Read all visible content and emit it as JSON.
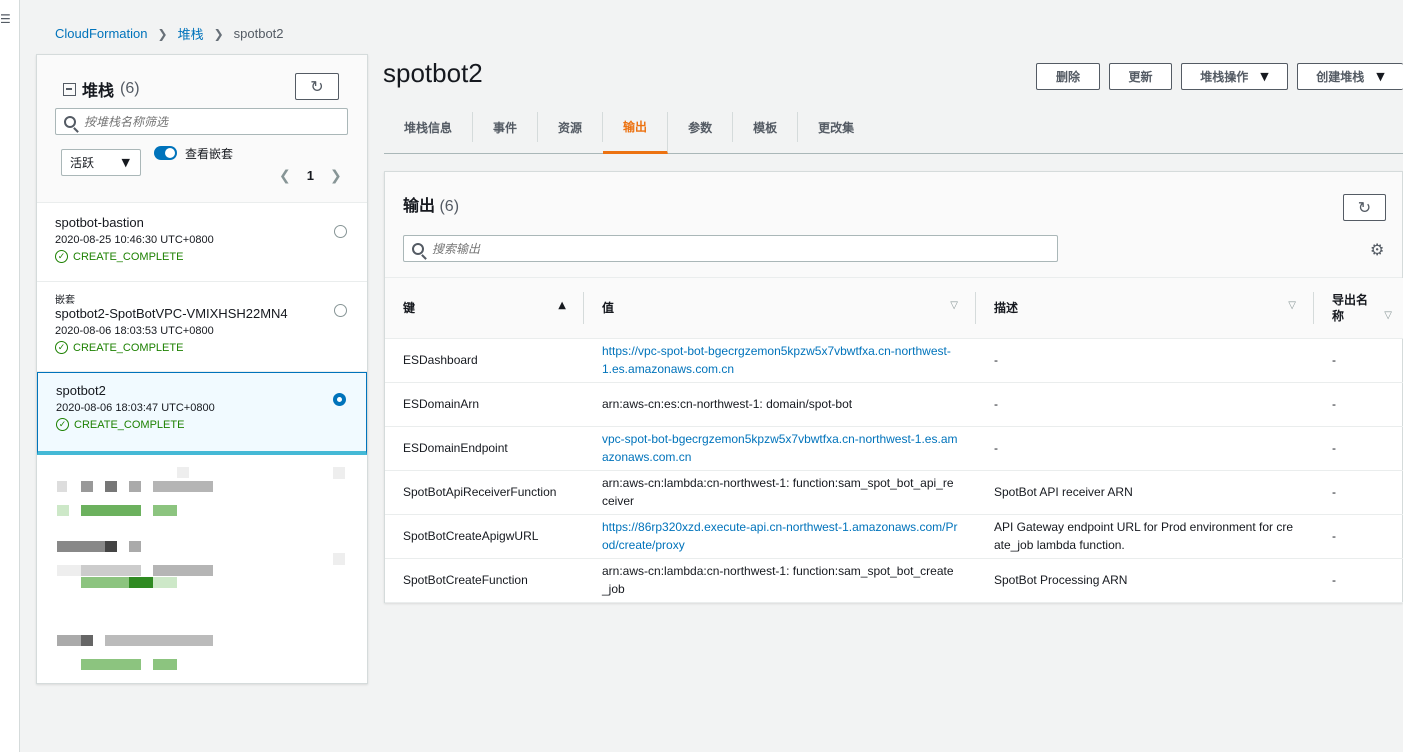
{
  "breadcrumb": {
    "items": [
      "CloudFormation",
      "堆栈"
    ],
    "current": "spotbot2"
  },
  "stacks_panel": {
    "title": "堆栈",
    "count": "(6)",
    "search_placeholder": "按堆栈名称筛选",
    "status_filter": "活跃",
    "toggle_label": "查看嵌套",
    "page": "1",
    "items": [
      {
        "nested_label": "",
        "name": "spotbot-bastion",
        "time": "2020-08-25 10:46:30 UTC+0800",
        "status": "CREATE_COMPLETE"
      },
      {
        "nested_label": "嵌套",
        "name": "spotbot2-SpotBotVPC-VMIXHSH22MN4",
        "time": "2020-08-06 18:03:53 UTC+0800",
        "status": "CREATE_COMPLETE"
      },
      {
        "nested_label": "",
        "name": "spotbot2",
        "time": "2020-08-06 18:03:47 UTC+0800",
        "status": "CREATE_COMPLETE"
      }
    ]
  },
  "page": {
    "title": "spotbot2",
    "buttons": {
      "delete": "删除",
      "update": "更新",
      "stack_actions": "堆栈操作",
      "create_stack": "创建堆栈"
    }
  },
  "tabs": [
    "堆栈信息",
    "事件",
    "资源",
    "输出",
    "参数",
    "模板",
    "更改集"
  ],
  "outputs": {
    "title": "输出",
    "count": "(6)",
    "search_placeholder": "搜索输出",
    "columns": [
      "键",
      "值",
      "描述",
      "导出名称"
    ],
    "rows": [
      {
        "key": "ESDashboard",
        "value": "https://vpc-spot-bot-bgecrgzemon5kpzw5x7vbwtfxa.cn-northwest-1.es.amazonaws.com.cn",
        "link": true,
        "desc": "-",
        "export": "-"
      },
      {
        "key": "ESDomainArn",
        "value": "arn:aws-cn:es:cn-northwest-1:                    domain/spot-bot",
        "link": false,
        "desc": "-",
        "export": "-"
      },
      {
        "key": "ESDomainEndpoint",
        "value": "vpc-spot-bot-bgecrgzemon5kpzw5x7vbwtfxa.cn-northwest-1.es.amazonaws.com.cn",
        "link": true,
        "desc": "-",
        "export": "-"
      },
      {
        "key": "SpotBotApiReceiverFunction",
        "value": "arn:aws-cn:lambda:cn-northwest-1:                    function:sam_spot_bot_api_receiver",
        "link": false,
        "desc": "SpotBot API receiver ARN",
        "export": "-"
      },
      {
        "key": "SpotBotCreateApigwURL",
        "value": "https://86rp320xzd.execute-api.cn-northwest-1.amazonaws.com/Prod/create/proxy",
        "link": true,
        "desc": "API Gateway endpoint URL for Prod environment for create_job lambda function.",
        "export": "-"
      },
      {
        "key": "SpotBotCreateFunction",
        "value": "arn:aws-cn:lambda:cn-northwest-1:                    function:sam_spot_bot_create_job",
        "link": false,
        "desc": "SpotBot Processing ARN",
        "export": "-"
      }
    ]
  },
  "colors": {
    "link": "#0073bb",
    "success": "#1d8102",
    "active_tab": "#ec7211"
  }
}
